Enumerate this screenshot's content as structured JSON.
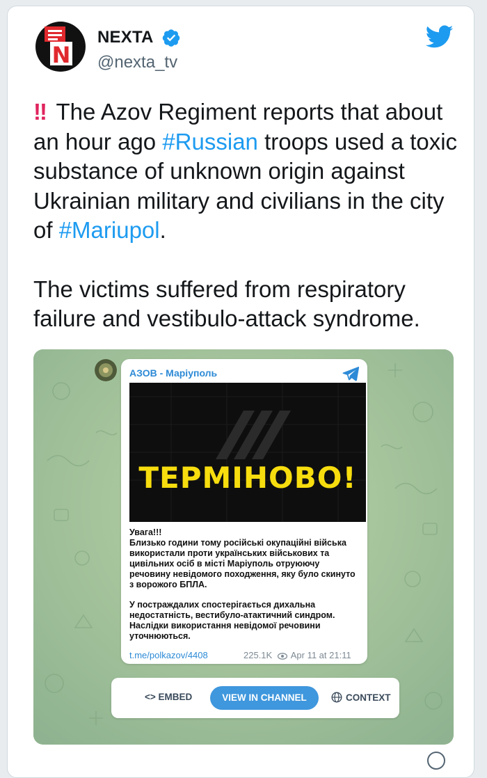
{
  "account": {
    "name": "NEXTA",
    "handle": "@nexta_tv",
    "verified": true,
    "avatar_letter": "N"
  },
  "tweet": {
    "alarm_glyph": "‼",
    "paragraph1": {
      "before": " The Azov Regiment reports that about an hour ago ",
      "hashtag1": "#Russian",
      "middle": " troops used a toxic substance of unknown origin against Ukrainian military and civilians in the city of ",
      "hashtag2": "#Mariupol",
      "after": "."
    },
    "paragraph2": "The victims suffered from respiratory failure and vestibulo-attack syndrome."
  },
  "telegram_post": {
    "channel_name": "АЗОВ - Маріуполь",
    "promo_text": "ТЕРМІНОВО!",
    "body_paragraph1": "Увага!!!\nБлизько години тому російські окупаційні війська використали проти українських військових та цивільних осіб в місті Маріуполь отруюючу речовину невідомого походження, яку було скинуто з ворожого БПЛА.",
    "body_paragraph2": "У постраждалих спостерігається дихальна недостатність, вестибуло-атактичний синдром. Наслідки використання невідомої речовини уточнюються.",
    "link": "t.me/polkazov/4408",
    "views": "225.1K",
    "date": "Apr 11 at 21:11"
  },
  "buttons": {
    "embed": "<> EMBED",
    "view_in_channel": "VIEW IN CHANNEL",
    "context": "CONTEXT"
  },
  "colors": {
    "accent": "#1d9bf0",
    "alarm": "#e0245e",
    "telegram_blue": "#3f97dd",
    "promo_yellow": "#f7dd0e",
    "chat_background": "#a8c69b"
  },
  "icons": [
    "verified-badge-icon",
    "twitter-bird-icon",
    "telegram-icon",
    "eye-icon",
    "globe-icon"
  ]
}
